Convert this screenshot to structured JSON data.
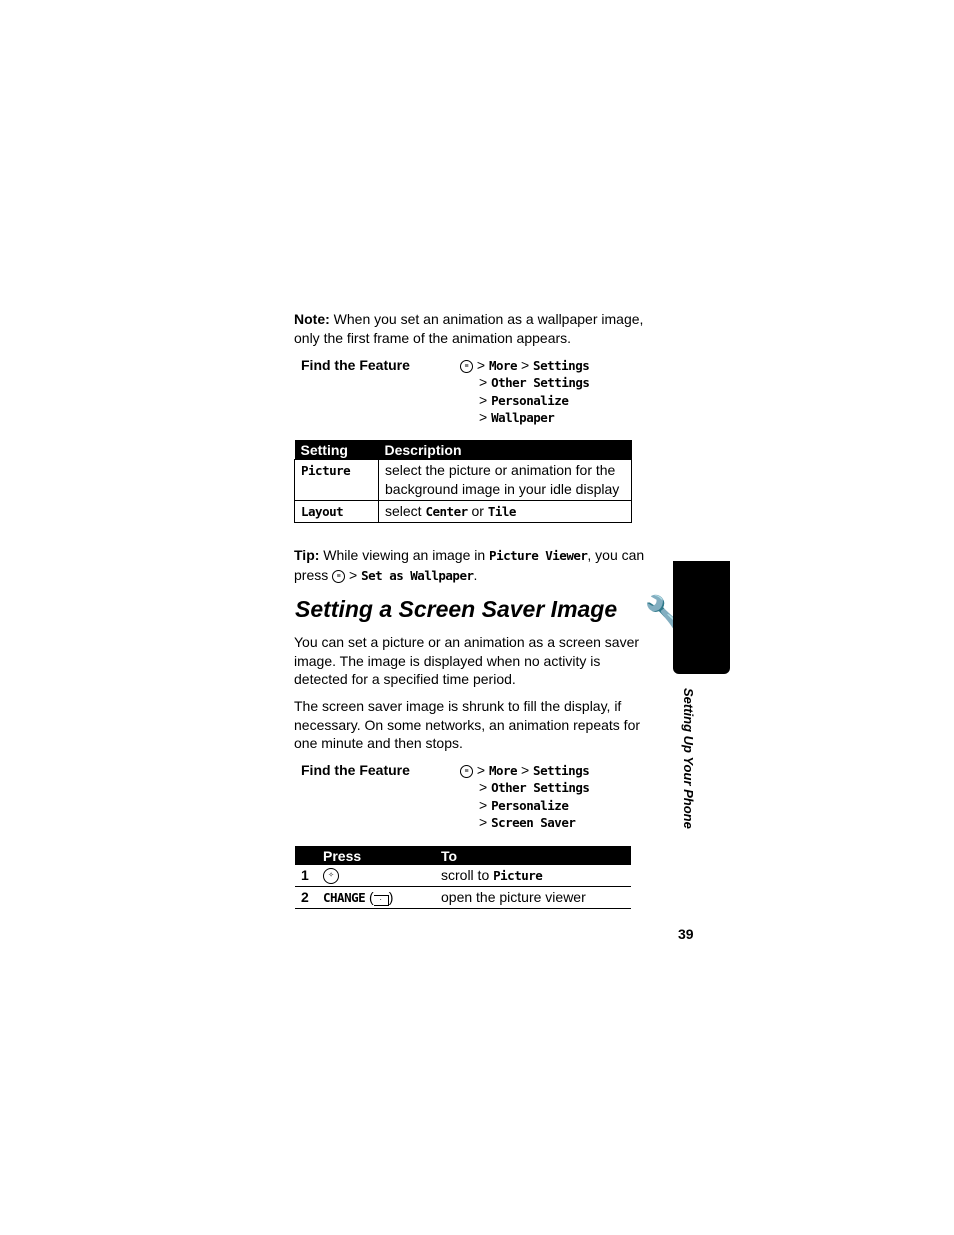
{
  "note": {
    "label": "Note:",
    "text": " When you set an animation as a wallpaper image, only the first frame of the animation appears."
  },
  "find1": {
    "label": "Find the Feature",
    "sep": ">",
    "steps": [
      "More",
      "Settings",
      "Other Settings",
      "Personalize",
      "Wallpaper"
    ]
  },
  "table1": {
    "headers": [
      "Setting",
      "Description"
    ],
    "rows": [
      {
        "setting": "Picture",
        "desc": "select the picture or animation for the background image in your idle display"
      },
      {
        "setting": "Layout",
        "desc_pre": "select ",
        "opt1": "Center",
        "mid": " or ",
        "opt2": "Tile"
      }
    ]
  },
  "tip": {
    "label": "Tip:",
    "t1": " While viewing an image in ",
    "app": "Picture Viewer",
    "t2": ", you can press ",
    "t3": " > ",
    "action": "Set as Wallpaper",
    "t4": "."
  },
  "heading": "Setting a Screen Saver Image",
  "para1": "You can set a picture or an animation as a screen saver image. The image is displayed when no activity is detected for a specified time period.",
  "para2": "The screen saver image is shrunk to fill the display, if necessary. On some networks, an animation repeats for one minute and then stops.",
  "find2": {
    "label": "Find the Feature",
    "sep": ">",
    "steps": [
      "More",
      "Settings",
      "Other Settings",
      "Personalize",
      "Screen Saver"
    ]
  },
  "table2": {
    "headers": [
      "",
      "Press",
      "To"
    ],
    "rows": [
      {
        "num": "1",
        "press": "",
        "to_pre": "scroll to ",
        "to_item": "Picture"
      },
      {
        "num": "2",
        "press": "CHANGE",
        "to": "open the picture viewer"
      }
    ]
  },
  "side_tab": "Setting Up Your Phone",
  "page_number": "39"
}
